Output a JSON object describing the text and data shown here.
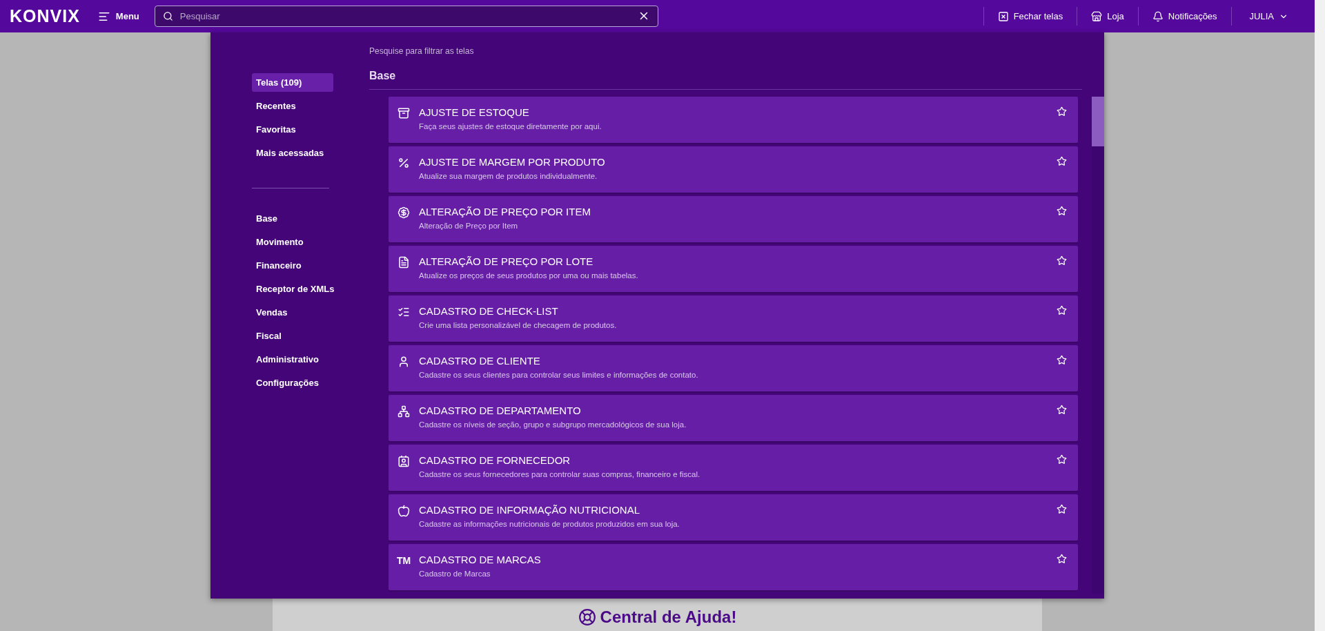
{
  "topbar": {
    "logo": "KONVIX",
    "menu_label": "Menu",
    "search": {
      "placeholder": "Pesquisar"
    },
    "actions": [
      {
        "label": "Fechar telas"
      },
      {
        "label": "Loja"
      },
      {
        "label": "Notificações"
      }
    ],
    "user": "JULIA"
  },
  "background": {
    "help_title": "Central de Ajuda!"
  },
  "panel": {
    "hint": "Pesquise para filtrar as telas",
    "filters": [
      {
        "label": "Telas (109)",
        "selected": true
      },
      {
        "label": "Recentes",
        "selected": false
      },
      {
        "label": "Favoritas",
        "selected": false
      },
      {
        "label": "Mais acessadas",
        "selected": false
      }
    ],
    "categories": [
      {
        "label": "Base",
        "selected": false
      },
      {
        "label": "Movimento",
        "selected": false
      },
      {
        "label": "Financeiro",
        "selected": false
      },
      {
        "label": "Receptor de XMLs",
        "selected": false
      },
      {
        "label": "Vendas",
        "selected": false
      },
      {
        "label": "Fiscal",
        "selected": false
      },
      {
        "label": "Administrativo",
        "selected": false
      },
      {
        "label": "Configurações",
        "selected": false
      }
    ],
    "section": "Base",
    "screens": [
      {
        "title": "AJUSTE DE ESTOQUE",
        "description": "Faça seus ajustes de estoque diretamente por aqui.",
        "favorite": false
      },
      {
        "title": "AJUSTE DE MARGEM POR PRODUTO",
        "description": "Atualize sua margem de produtos individualmente.",
        "favorite": false
      },
      {
        "title": "ALTERAÇÃO DE PREÇO POR ITEM",
        "description": "Alteração de Preço por Item",
        "favorite": false
      },
      {
        "title": "ALTERAÇÃO DE PREÇO POR LOTE",
        "description": "Atualize os preços de seus produtos por uma ou mais tabelas.",
        "favorite": false
      },
      {
        "title": "CADASTRO DE CHECK-LIST",
        "description": "Crie uma lista personalizável de checagem de produtos.",
        "favorite": false
      },
      {
        "title": "CADASTRO DE CLIENTE",
        "description": "Cadastre os seus clientes para controlar seus limites e informações de contato.",
        "favorite": false
      },
      {
        "title": "CADASTRO DE DEPARTAMENTO",
        "description": "Cadastre os níveis de seção, grupo e subgrupo mercadológicos de sua loja.",
        "favorite": false
      },
      {
        "title": "CADASTRO DE FORNECEDOR",
        "description": "Cadastre os seus fornecedores para controlar suas compras, financeiro e fiscal.",
        "favorite": false
      },
      {
        "title": "CADASTRO DE INFORMAÇÃO NUTRICIONAL",
        "description": "Cadastre as informações nutricionais de produtos produzidos em sua loja.",
        "favorite": false
      },
      {
        "title": "CADASTRO DE MARCAS",
        "description": "Cadastro de Marcas",
        "favorite": false,
        "icon_text": "TM"
      }
    ]
  }
}
